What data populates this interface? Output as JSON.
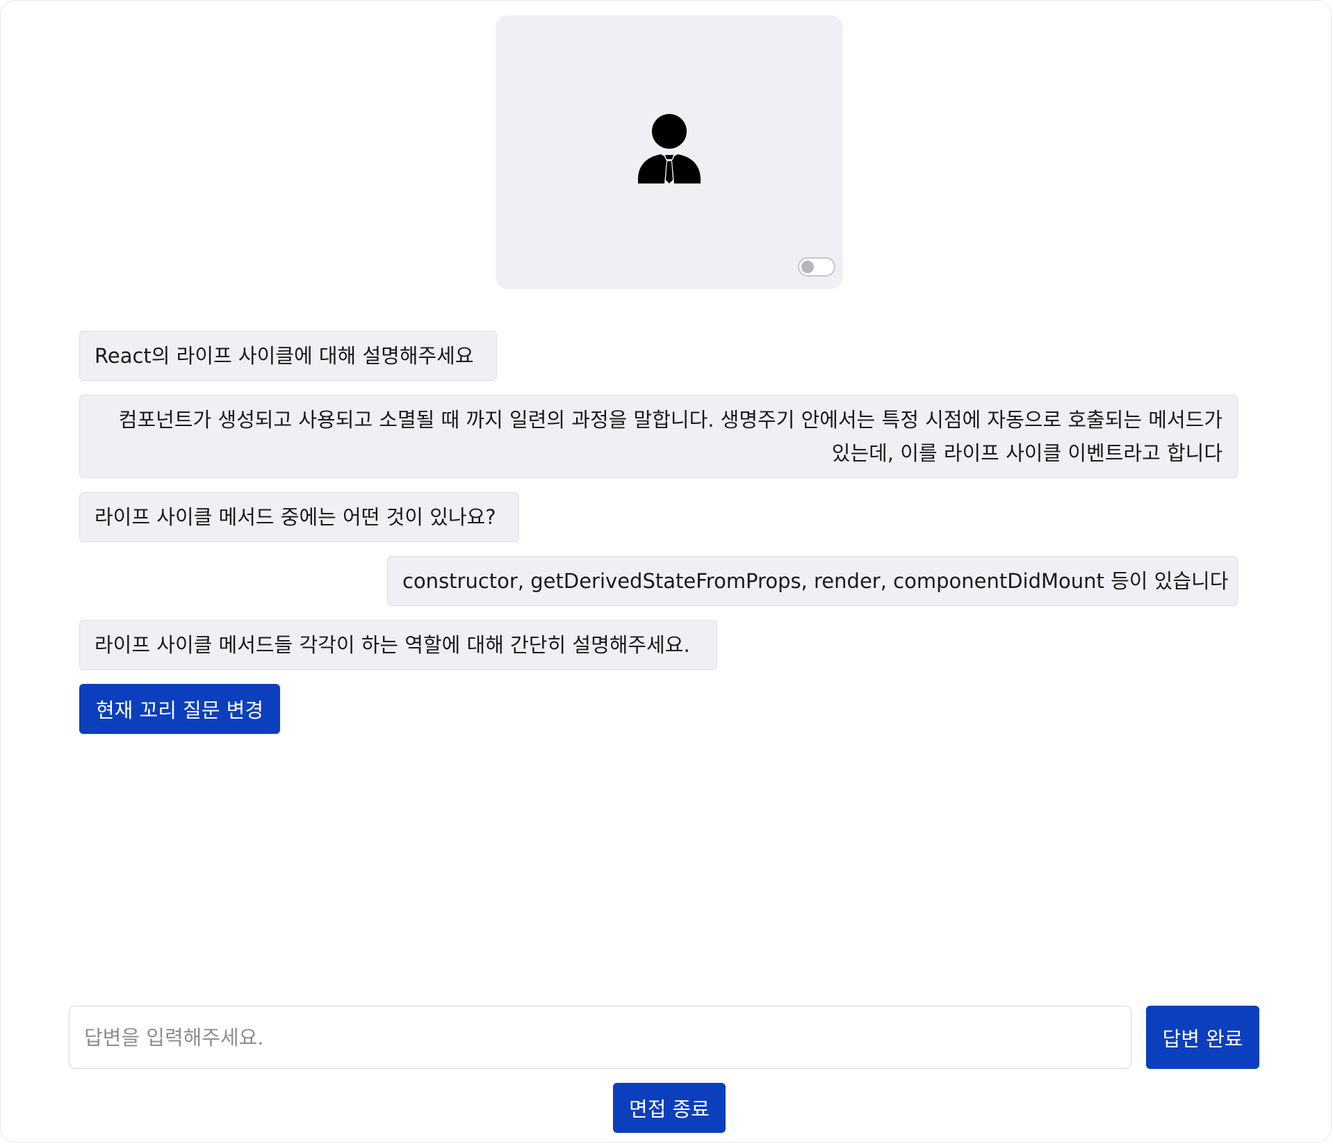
{
  "interviewer": {
    "icon": "businessman-icon",
    "video_toggle_on": false
  },
  "chat": {
    "messages": [
      {
        "role": "question",
        "text": "React의 라이프 사이클에 대해 설명해주세요"
      },
      {
        "role": "answer",
        "text": "컴포넌트가 생성되고 사용되고 소멸될 때 까지 일련의 과정을 말합니다. 생명주기 안에서는 특정 시점에 자동으로 호출되는 메서드가 있는데, 이를 라이프 사이클 이벤트라고 합니다"
      },
      {
        "role": "question",
        "text": "라이프 사이클 메서드 중에는 어떤 것이 있나요?"
      },
      {
        "role": "answer",
        "text": "constructor, getDerivedStateFromProps, render, componentDidMount 등이 있습니다"
      },
      {
        "role": "question",
        "text": "라이프 사이클 메서드들 각각이 하는 역할에 대해 간단히 설명해주세요."
      }
    ],
    "change_question_label": "현재 꼬리 질문 변경"
  },
  "composer": {
    "placeholder": "답변을 입력해주세요.",
    "value": "",
    "submit_label": "답변 완료"
  },
  "footer": {
    "end_interview_label": "면접 종료"
  },
  "colors": {
    "primary": "#0c3fbd",
    "bubble_bg": "#eff0f3",
    "card_bg": "#eff0f3"
  }
}
